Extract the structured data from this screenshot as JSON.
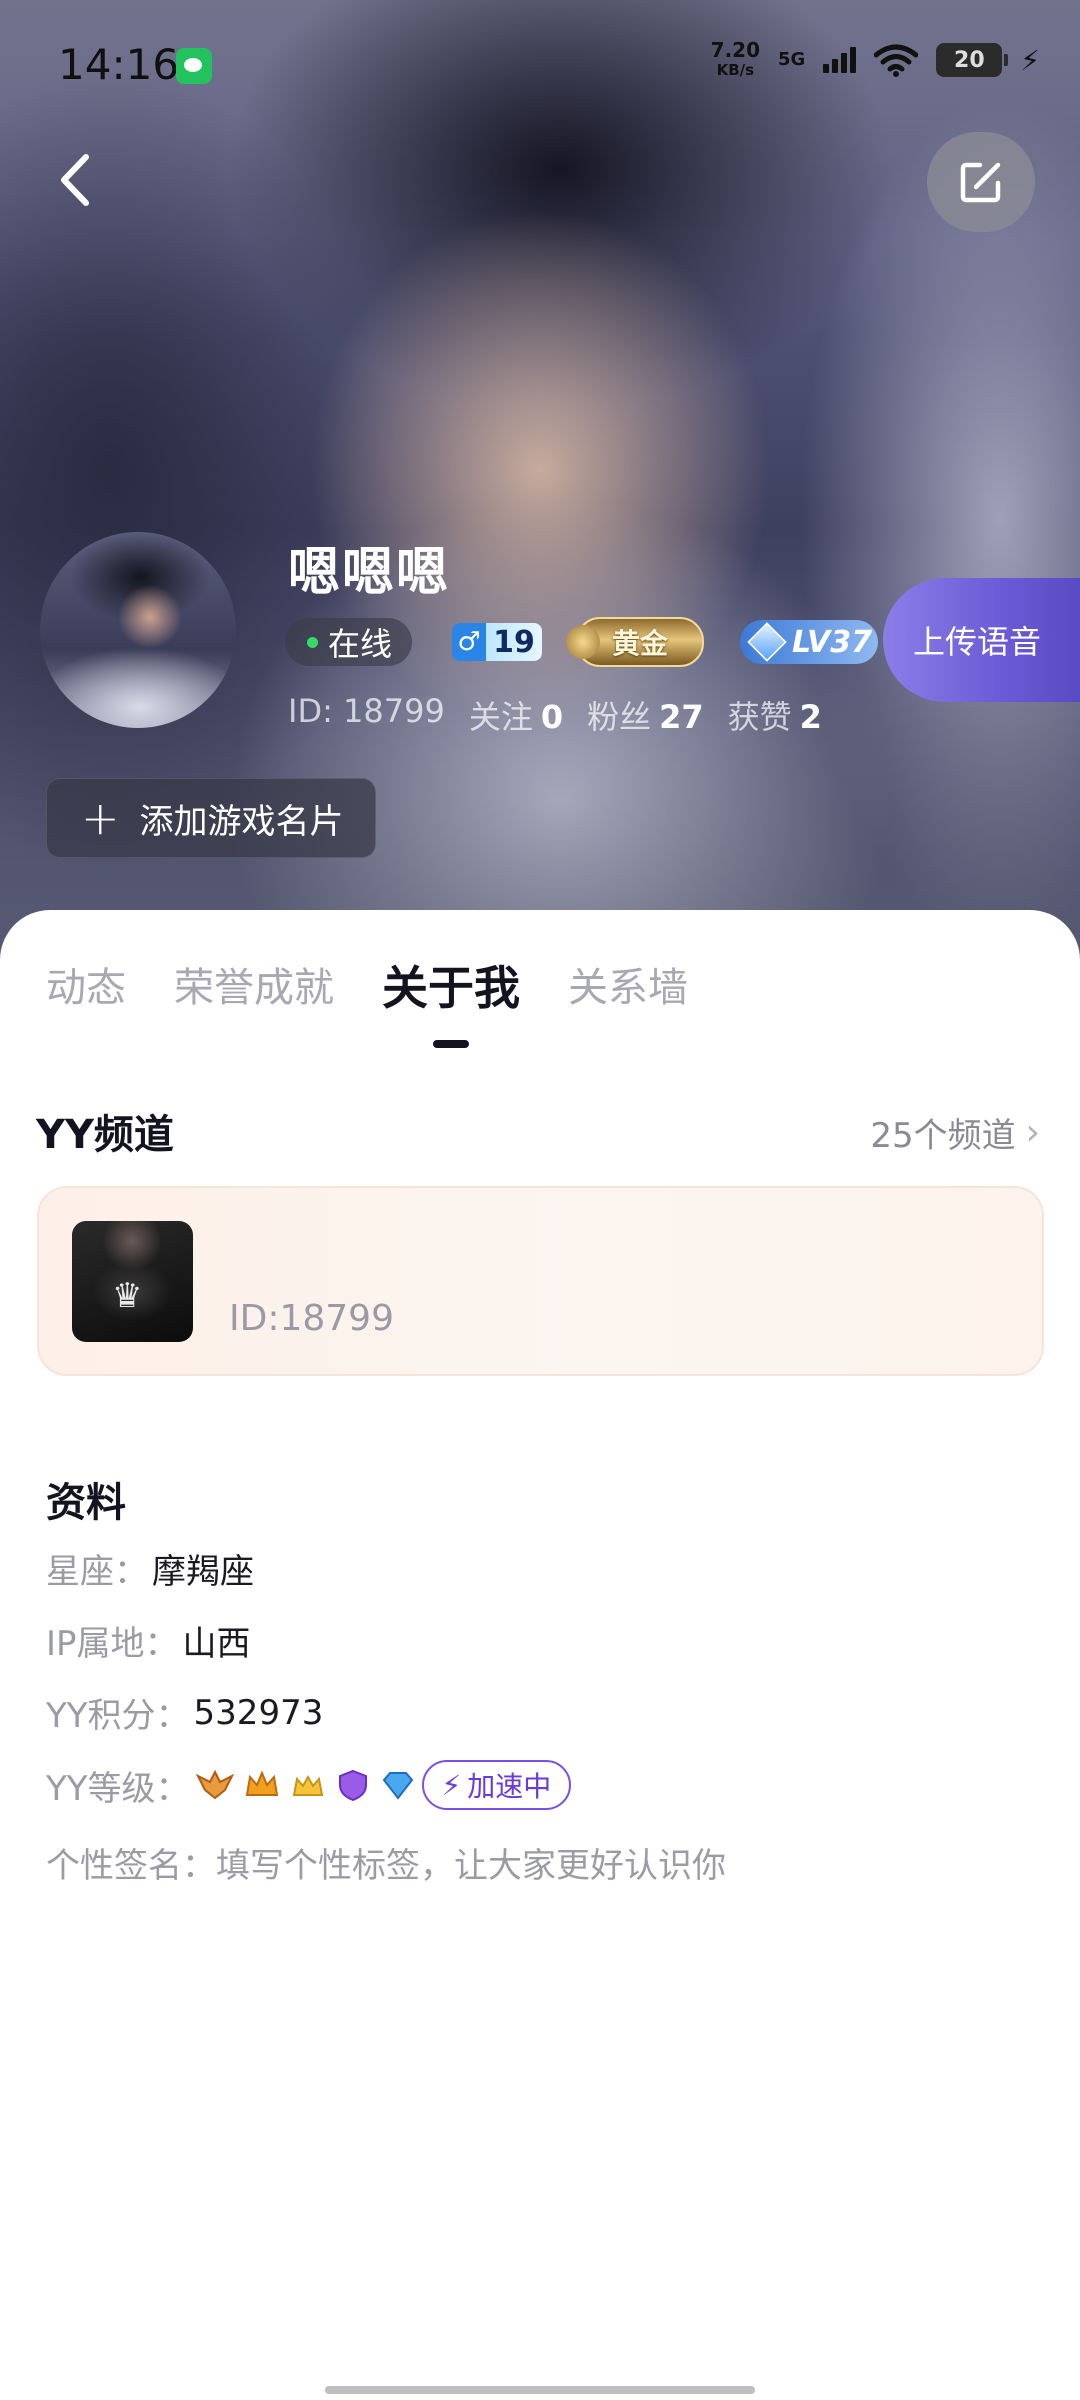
{
  "status_bar": {
    "time": "14:16",
    "network_speed": "7.20",
    "network_unit": "KB/s",
    "signal_type": "5G",
    "battery": "20"
  },
  "profile": {
    "name": "嗯嗯嗯",
    "online_label": "在线",
    "gender_symbol": "♂",
    "age": "19",
    "rank_badge": "黄金",
    "level_badge": "LV37",
    "upload_voice_label": "上传语音",
    "id_label": "ID:",
    "id_value": "18799",
    "following_label": "关注",
    "following_count": "0",
    "followers_label": "粉丝",
    "followers_count": "27",
    "likes_label": "获赞",
    "likes_count": "2",
    "add_game_card_label": "添加游戏名片"
  },
  "tabs": [
    {
      "label": "动态",
      "active": false
    },
    {
      "label": "荣誉成就",
      "active": false
    },
    {
      "label": "关于我",
      "active": true
    },
    {
      "label": "关系墙",
      "active": false
    }
  ],
  "channels": {
    "title": "YY频道",
    "count_label": "25个频道",
    "card_id": "ID:18799"
  },
  "info": {
    "title": "资料",
    "constellation_label": "星座：",
    "constellation_value": "摩羯座",
    "ip_label": "IP属地：",
    "ip_value": "山西",
    "points_label": "YY积分：",
    "points_value": "532973",
    "level_label": "YY等级：",
    "speed_label": "加速中",
    "signature_label": "个性签名：",
    "signature_value": "填写个性标签，让大家更好认识你"
  },
  "icons": {
    "back": "chevron-left-icon",
    "edit": "edit-icon",
    "level_icons": [
      "eagle-icon",
      "crown-icon",
      "small-crown-icon",
      "shield-icon",
      "diamond-icon"
    ]
  },
  "colors": {
    "accent_purple": "#6b5bd6",
    "online_green": "#37d86a",
    "speed_purple": "#7c4ee8"
  }
}
